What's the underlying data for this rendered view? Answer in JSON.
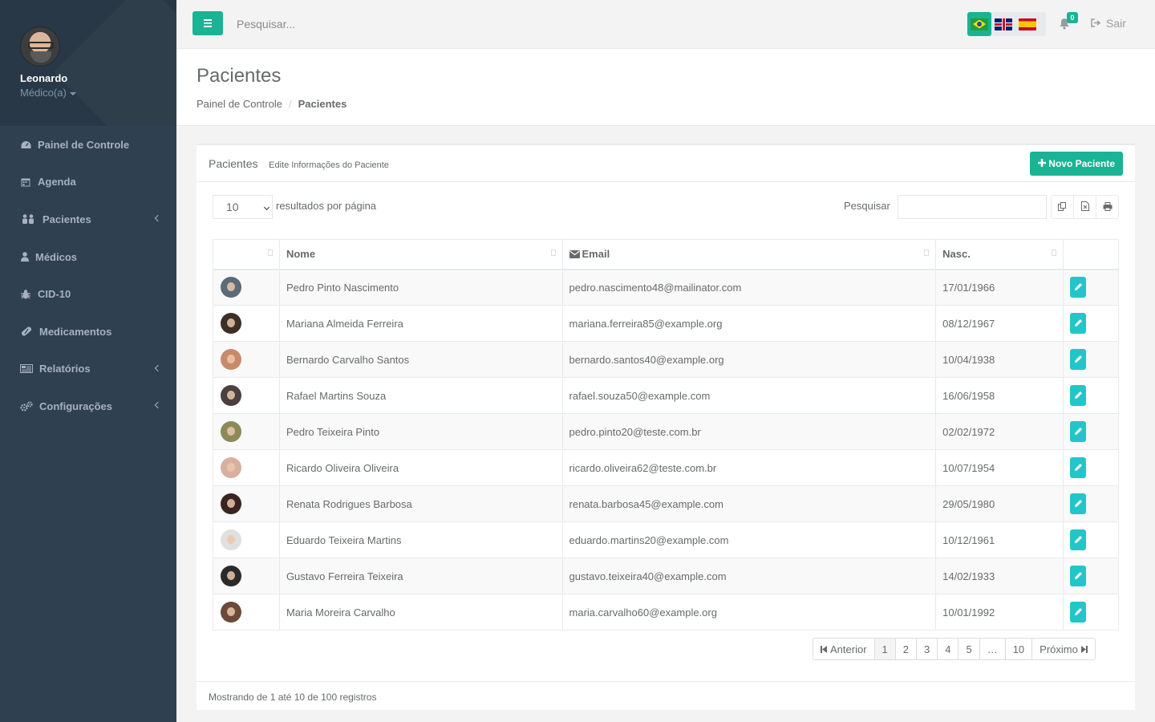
{
  "user": {
    "name": "Leonardo",
    "role": "Médico(a)"
  },
  "sidebar": {
    "items": [
      {
        "label": "Painel de Controle",
        "icon": "dashboard-icon",
        "has_arrow": false
      },
      {
        "label": "Agenda",
        "icon": "calendar-icon",
        "has_arrow": false
      },
      {
        "label": "Pacientes",
        "icon": "users-icon",
        "has_arrow": true
      },
      {
        "label": "Médicos",
        "icon": "user-icon",
        "has_arrow": false
      },
      {
        "label": "CID-10",
        "icon": "bug-icon",
        "has_arrow": false
      },
      {
        "label": "Medicamentos",
        "icon": "pill-icon",
        "has_arrow": false
      },
      {
        "label": "Relatórios",
        "icon": "report-icon",
        "has_arrow": true
      },
      {
        "label": "Configurações",
        "icon": "cogs-icon",
        "has_arrow": true
      }
    ]
  },
  "topbar": {
    "search_placeholder": "Pesquisar...",
    "notifications": "0",
    "logout_label": "Sair",
    "languages": [
      "pt-BR",
      "en-GB",
      "es-ES"
    ],
    "active_language": "pt-BR"
  },
  "page": {
    "title": "Pacientes",
    "breadcrumb": {
      "home": "Painel de Controle",
      "current": "Pacientes"
    }
  },
  "panel": {
    "title": "Pacientes",
    "subtitle": "Edite Informações do Paciente",
    "new_button": "Novo Paciente",
    "page_length": "10",
    "page_length_label": "resultados por página",
    "search_label": "Pesquisar",
    "columns": {
      "name": "Nome",
      "email": "Email",
      "birth": "Nasc."
    },
    "rows": [
      {
        "name": "Pedro Pinto Nascimento",
        "email": "pedro.nascimento48@mailinator.com",
        "birth": "17/01/1966",
        "avatar_color": "#5b6b78"
      },
      {
        "name": "Mariana Almeida Ferreira",
        "email": "mariana.ferreira85@example.org",
        "birth": "08/12/1967",
        "avatar_color": "#3b2f26"
      },
      {
        "name": "Bernardo Carvalho Santos",
        "email": "bernardo.santos40@example.org",
        "birth": "10/04/1938",
        "avatar_color": "#c98a6a"
      },
      {
        "name": "Rafael Martins Souza",
        "email": "rafael.souza50@example.com",
        "birth": "16/06/1958",
        "avatar_color": "#4a4040"
      },
      {
        "name": "Pedro Teixeira Pinto",
        "email": "pedro.pinto20@teste.com.br",
        "birth": "02/02/1972",
        "avatar_color": "#8a8a5a"
      },
      {
        "name": "Ricardo Oliveira Oliveira",
        "email": "ricardo.oliveira62@teste.com.br",
        "birth": "10/07/1954",
        "avatar_color": "#d8b0a0"
      },
      {
        "name": "Renata Rodrigues Barbosa",
        "email": "renata.barbosa45@example.com",
        "birth": "29/05/1980",
        "avatar_color": "#3a2420"
      },
      {
        "name": "Eduardo Teixeira Martins",
        "email": "eduardo.martins20@example.com",
        "birth": "10/12/1961",
        "avatar_color": "#e0e0e0"
      },
      {
        "name": "Gustavo Ferreira Teixeira",
        "email": "gustavo.teixeira40@example.com",
        "birth": "14/02/1933",
        "avatar_color": "#2a2a2a"
      },
      {
        "name": "Maria Moreira Carvalho",
        "email": "maria.carvalho60@example.org",
        "birth": "10/01/1992",
        "avatar_color": "#6a4a3a"
      }
    ],
    "pagination": {
      "prev": "Anterior",
      "pages": [
        "1",
        "2",
        "3",
        "4",
        "5",
        "…",
        "10"
      ],
      "active": "1",
      "next": "Próximo"
    },
    "footer": "Mostrando de 1 até 10 de 100 registros"
  },
  "colors": {
    "accent": "#1ab394",
    "info": "#23c6c8",
    "sidebar": "#2f4050"
  }
}
